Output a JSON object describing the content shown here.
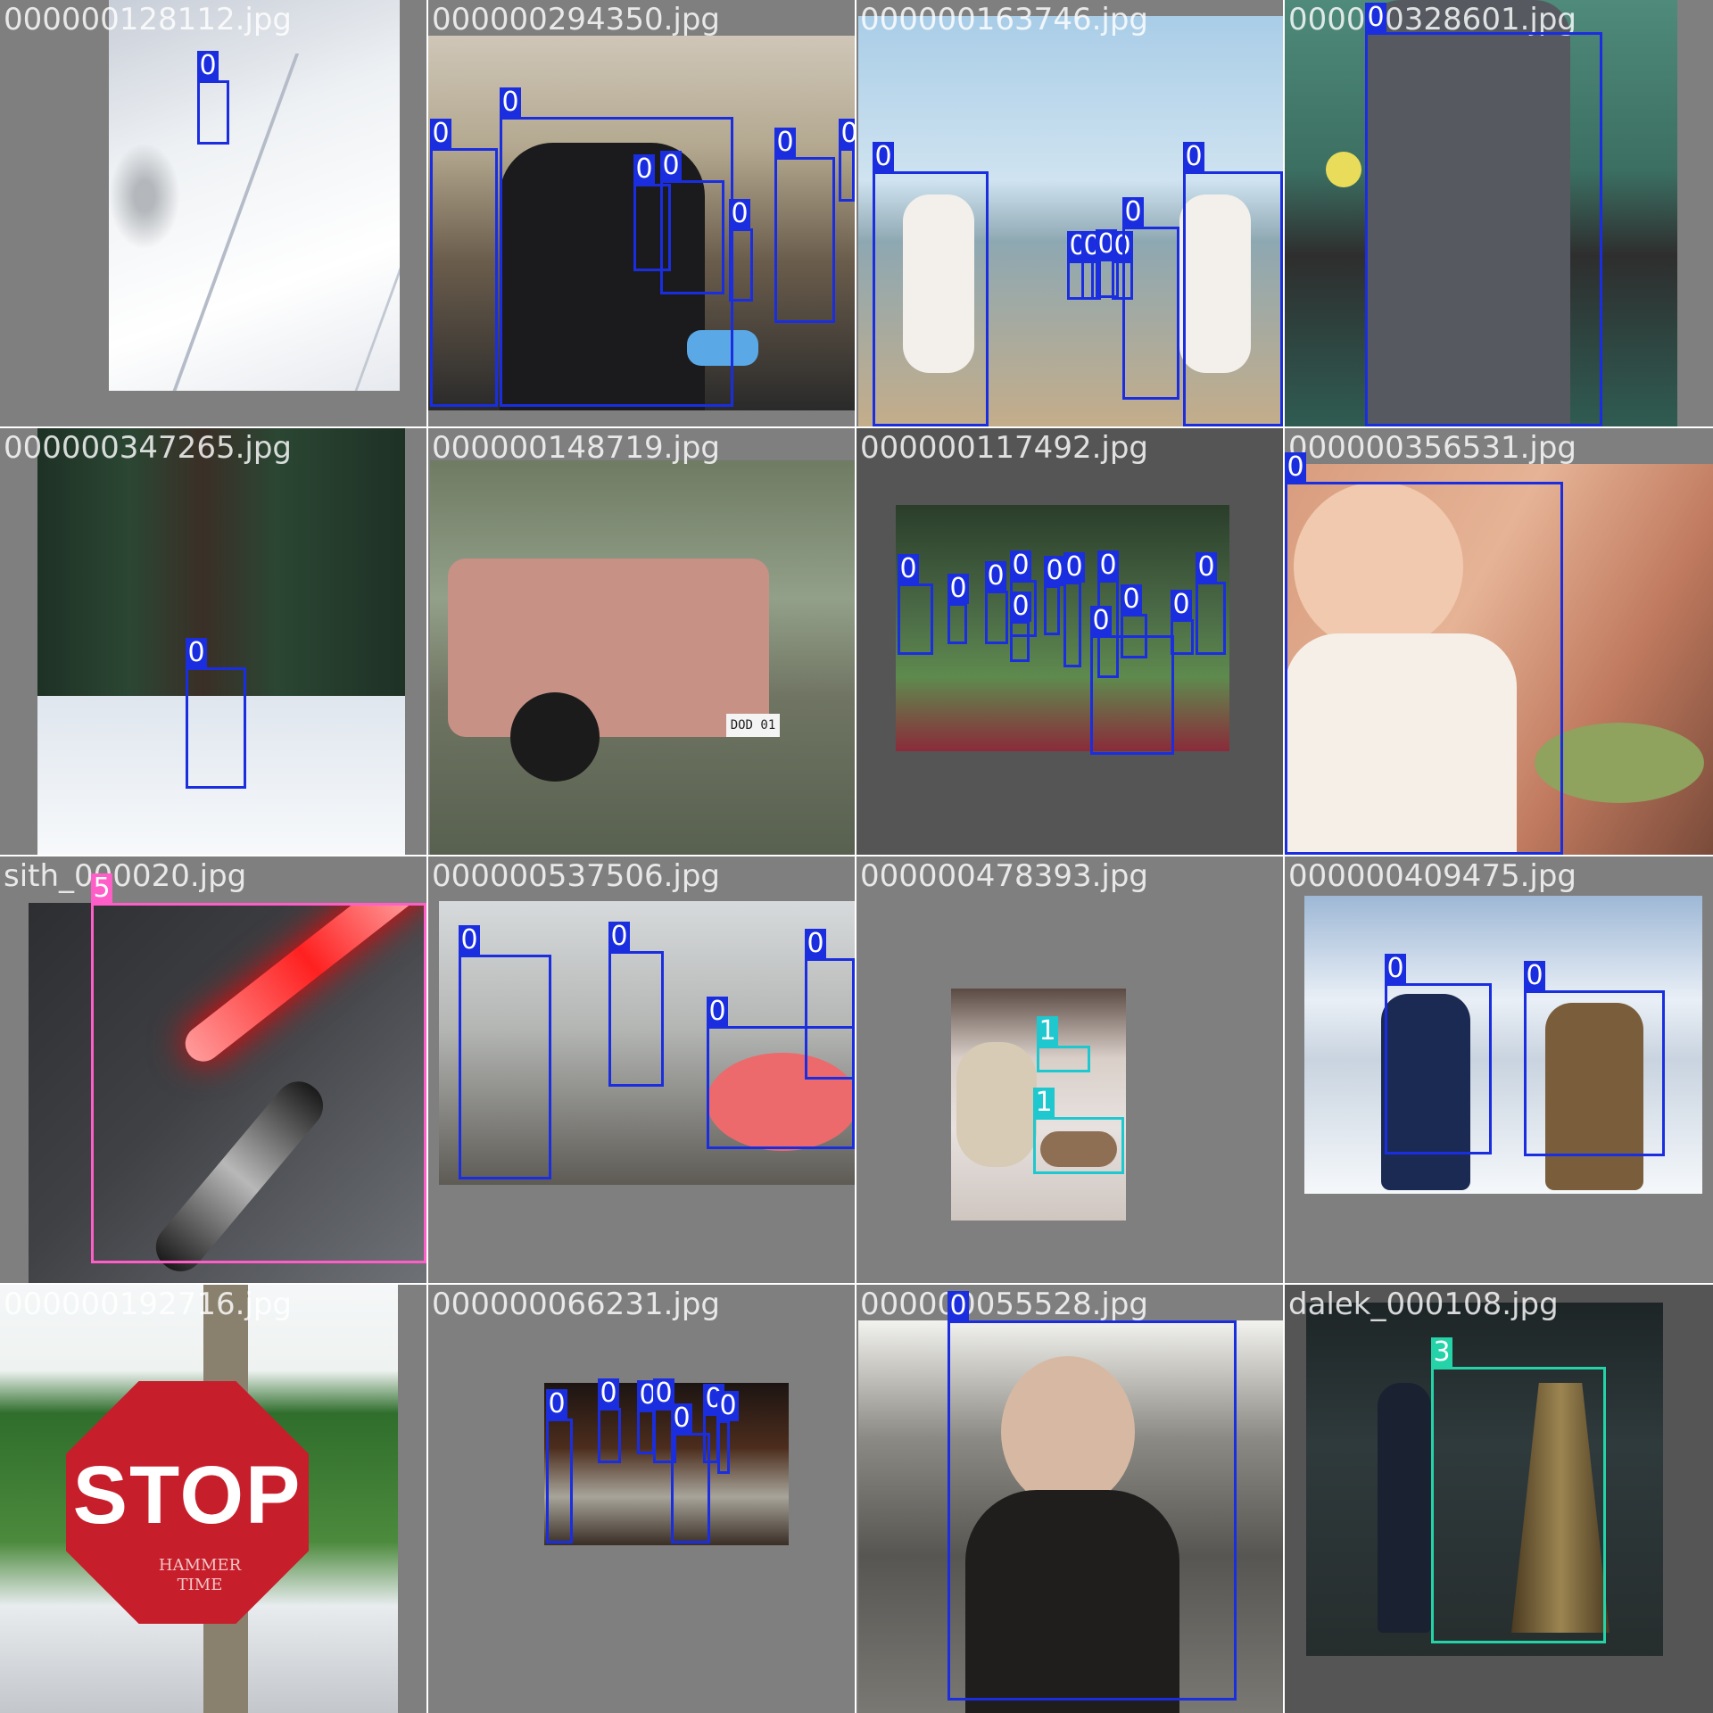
{
  "colors": {
    "class_0": "#1a2ee0",
    "class_1": "#1fc7cf",
    "class_3": "#24d3a8",
    "class_5": "#ff5ec8"
  },
  "tiles": [
    {
      "filename": "000000128112.jpg",
      "boxes": [
        "0"
      ]
    },
    {
      "filename": "000000294350.jpg",
      "boxes": [
        "0",
        "0",
        "0",
        "0",
        "0",
        "0",
        "0"
      ]
    },
    {
      "filename": "000000163746.jpg",
      "boxes": [
        "0",
        "0",
        "0",
        "0",
        "0",
        "0",
        "0"
      ]
    },
    {
      "filename": "000000328601.jpg",
      "boxes": [
        "0"
      ]
    },
    {
      "filename": "000000347265.jpg",
      "boxes": [
        "0"
      ]
    },
    {
      "filename": "000000148719.jpg",
      "boxes": []
    },
    {
      "filename": "000000117492.jpg",
      "boxes": [
        "0",
        "0",
        "0",
        "0",
        "0",
        "0",
        "0",
        "0",
        "0",
        "0",
        "0",
        "0"
      ]
    },
    {
      "filename": "000000356531.jpg",
      "boxes": [
        "0"
      ]
    },
    {
      "filename": "sith_000020.jpg",
      "boxes": [
        "5"
      ]
    },
    {
      "filename": "000000537506.jpg",
      "boxes": [
        "0",
        "0",
        "0",
        "0"
      ]
    },
    {
      "filename": "000000478393.jpg",
      "boxes": [
        "1",
        "1"
      ]
    },
    {
      "filename": "000000409475.jpg",
      "boxes": [
        "0",
        "0"
      ]
    },
    {
      "filename": "000000192716.jpg",
      "boxes": []
    },
    {
      "filename": "000000066231.jpg",
      "boxes": [
        "0",
        "0",
        "0",
        "0",
        "0",
        "0",
        "0"
      ]
    },
    {
      "filename": "000000055528.jpg",
      "boxes": [
        "0"
      ]
    },
    {
      "filename": "dalek_000108.jpg",
      "boxes": [
        "3"
      ]
    }
  ],
  "sign": {
    "word": "STOP",
    "graffiti": "HAMMER TIME"
  },
  "plate": "DOD 01"
}
